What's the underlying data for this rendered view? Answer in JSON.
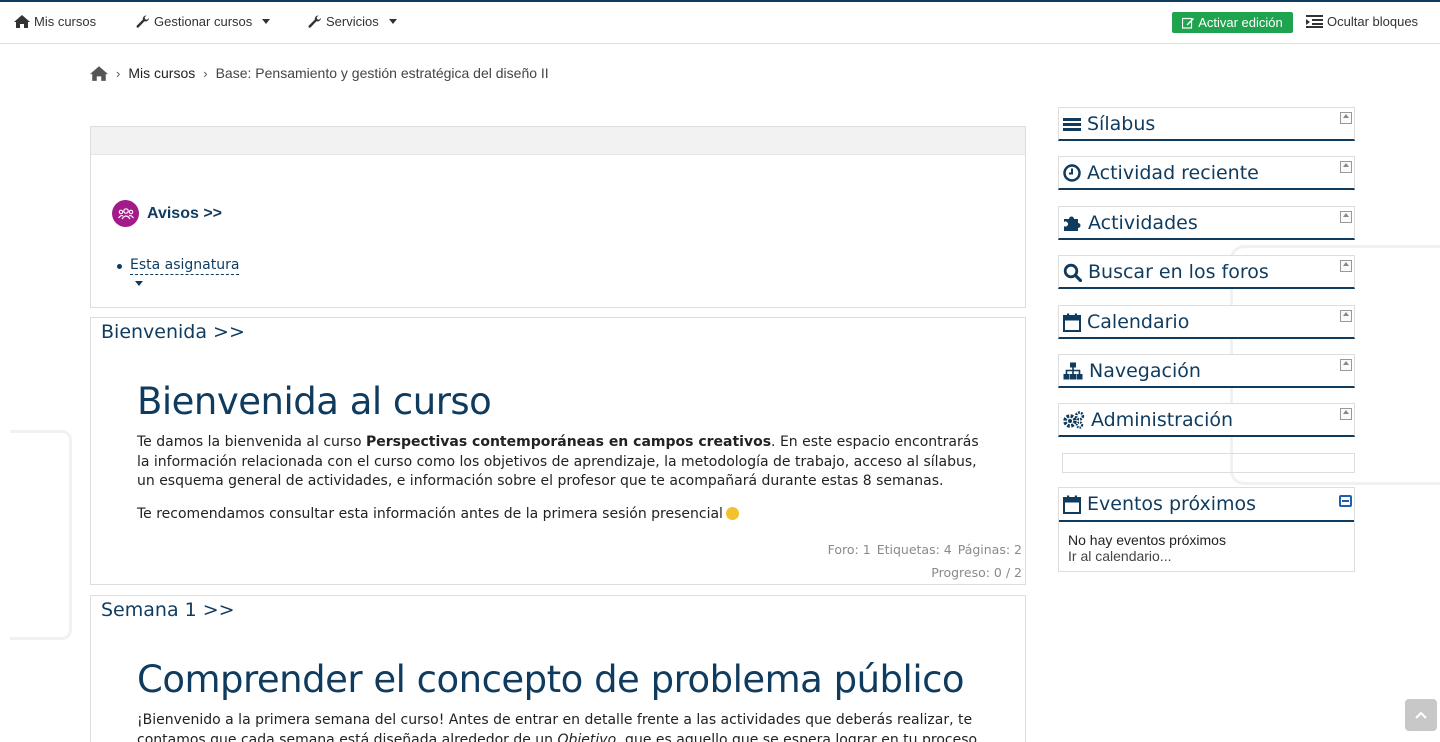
{
  "nav": {
    "my_courses": "Mis cursos",
    "manage_courses": "Gestionar cursos",
    "services": "Servicios",
    "edit_button": "Activar edición",
    "hide_blocks": "Ocultar bloques"
  },
  "breadcrumb": {
    "items": [
      "Mis cursos",
      "Base: Pensamiento y gestión estratégica del diseño II"
    ]
  },
  "avisos": {
    "title": "Avisos >>",
    "item": "Esta asignatura"
  },
  "sections": [
    {
      "title": "Bienvenida >>",
      "heading": "Bienvenida al curso",
      "para1_pre": "Te damos la bienvenida al curso ",
      "para1_bold": "Perspectivas contemporáneas en campos creativos",
      "para1_post": ". En este espacio encontrarás la información relacionada con el curso como los objetivos de aprendizaje, la metodología de trabajo, acceso al sílabus, un esquema general de actividades, e información sobre el profesor que te acompañará durante estas 8 semanas.",
      "para2": "Te recomendamos consultar esta información antes de la primera sesión presencial",
      "stats": [
        "Foro: 1",
        "Etiquetas: 4",
        "Páginas: 2"
      ],
      "progress": "Progreso: 0 / 2"
    },
    {
      "title": "Semana 1 >>",
      "heading": "Comprender el concepto de problema público",
      "para1_pre": "¡Bienvenido a la primera semana del curso! Antes de entrar en detalle frente a las actividades que deberás realizar, te contamos que cada semana está diseñada alrededor de un ",
      "para1_italic": "Objetivo",
      "para1_post": ", que es aquello que se espera lograr en tu proceso de"
    }
  ],
  "blocks": [
    {
      "label": "Sílabus",
      "icon": "list-icon"
    },
    {
      "label": "Actividad reciente",
      "icon": "clock-icon"
    },
    {
      "label": "Actividades",
      "icon": "puzzle-icon"
    },
    {
      "label": "Buscar en los foros",
      "icon": "search-icon"
    },
    {
      "label": "Calendario",
      "icon": "calendar-icon"
    },
    {
      "label": "Navegación",
      "icon": "sitemap-icon"
    },
    {
      "label": "Administración",
      "icon": "cogs-icon"
    }
  ],
  "events": {
    "title": "Eventos próximos",
    "none": "No hay eventos próximos",
    "link": "Ir al calendario..."
  },
  "colors": {
    "brand": "#0f3b5f",
    "edit_green": "#1ea44f",
    "avisos_icon": "#a31a8a"
  }
}
